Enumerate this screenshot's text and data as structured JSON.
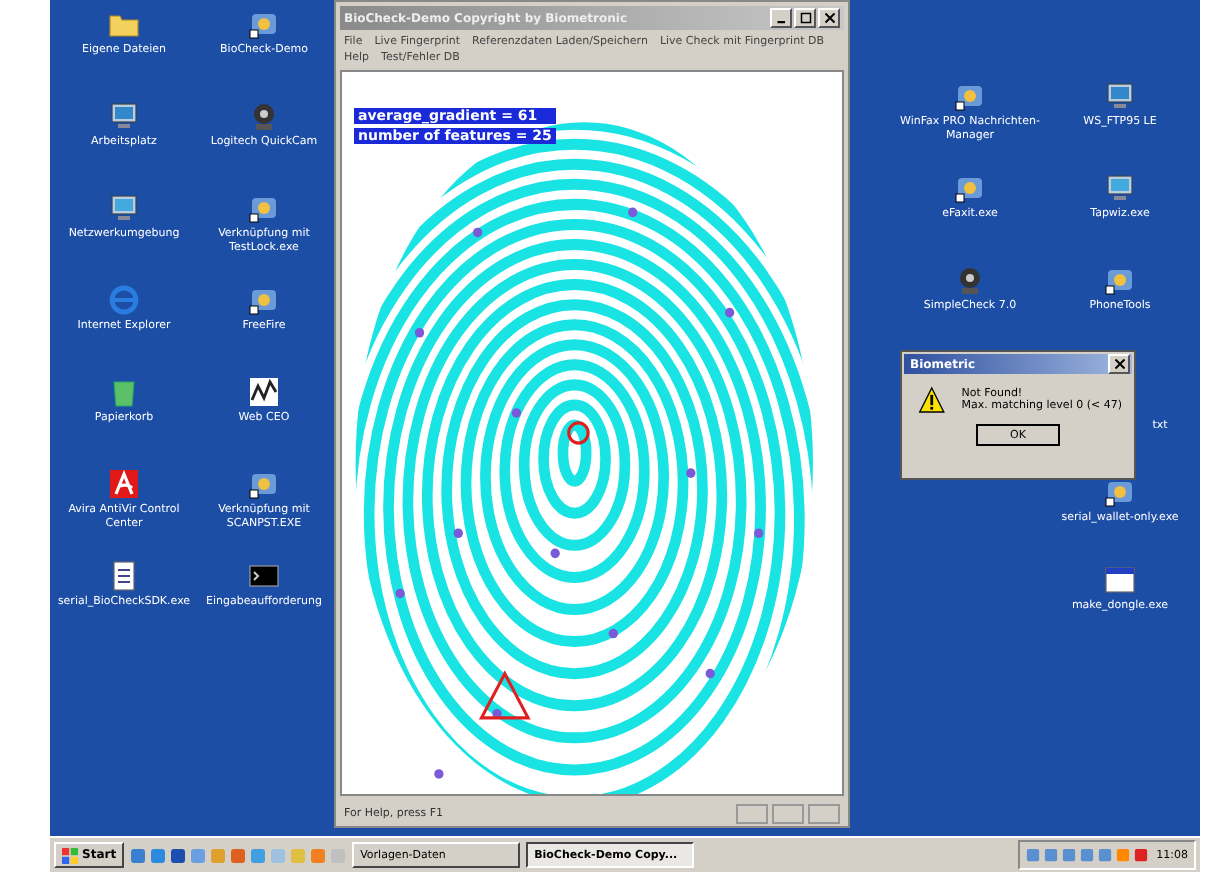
{
  "desktop": {
    "icons_left": [
      {
        "label": "Eigene Dateien",
        "kind": "folder"
      },
      {
        "label": "BioCheck-Demo",
        "kind": "app"
      },
      {
        "label": "Arbeitsplatz",
        "kind": "computer"
      },
      {
        "label": "Logitech QuickCam",
        "kind": "camera"
      },
      {
        "label": "Netzwerkumgebung",
        "kind": "network"
      },
      {
        "label": "Verknüpfung mit TestLock.exe",
        "kind": "app"
      },
      {
        "label": "Internet Explorer",
        "kind": "browser"
      },
      {
        "label": "FreeFire",
        "kind": "app"
      },
      {
        "label": "Papierkorb",
        "kind": "trash"
      },
      {
        "label": "Web CEO",
        "kind": "chart"
      },
      {
        "label": "Avira AntiVir Control Center",
        "kind": "shield"
      },
      {
        "label": "Verknüpfung mit SCANPST.EXE",
        "kind": "app"
      },
      {
        "label": "serial_BioCheckSDK.exe",
        "kind": "document"
      },
      {
        "label": "Eingabeaufforderung",
        "kind": "console"
      }
    ],
    "icons_right": [
      {
        "label": "WinFax PRO Nachrichten-Manager",
        "kind": "app"
      },
      {
        "label": "WS_FTP95 LE",
        "kind": "computer"
      },
      {
        "label": "eFaxit.exe",
        "kind": "app"
      },
      {
        "label": "Tapwiz.exe",
        "kind": "network"
      },
      {
        "label": "SimpleCheck 7.0",
        "kind": "camera"
      },
      {
        "label": "PhoneTools",
        "kind": "app"
      },
      {
        "label": "txt",
        "kind": "hidden"
      },
      {
        "label": "serial_wallet-only.exe",
        "kind": "app"
      },
      {
        "label": "make_dongle.exe",
        "kind": "window"
      }
    ]
  },
  "window": {
    "title": "BioCheck-Demo Copyright by Biometronic",
    "menu": [
      [
        "File",
        "Live Fingerprint",
        "Referenzdaten Laden/Speichern",
        "Live Check mit Fingerprint DB"
      ],
      [
        "Help",
        "Test/Fehler DB"
      ]
    ],
    "overlay": [
      "average_gradient = 61",
      "number of features = 25"
    ],
    "status_bar": "For Help, press F1"
  },
  "dialog": {
    "title": "Biometric",
    "message": [
      "Not Found!",
      "Max. matching level 0 (< 47)"
    ],
    "button": "OK"
  },
  "taskbar": {
    "start": "Start",
    "tasks": [
      {
        "label": "Vorlagen-Daten",
        "selected": false
      },
      {
        "label": "BioCheck-Demo Copy...",
        "selected": true
      }
    ],
    "clock": "11:08"
  }
}
